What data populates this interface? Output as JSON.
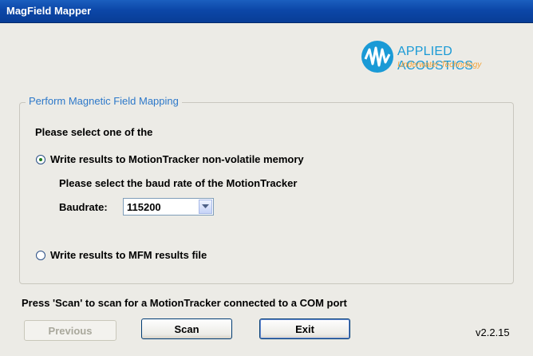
{
  "window": {
    "title": "MagField Mapper"
  },
  "logo": {
    "company": "APPLIED ACOUSTICS",
    "tagline": "Underwater Technology",
    "icon": "applied-acoustics-logo"
  },
  "group": {
    "legend": "Perform Magnetic Field Mapping",
    "prompt": "Please select one of the",
    "options": [
      {
        "label": "Write results to MotionTracker non-volatile memory",
        "selected": true
      },
      {
        "label": "Write results to MFM results file",
        "selected": false
      }
    ],
    "baud_prompt": "Please select the baud rate of the MotionTracker",
    "baud_label": "Baudrate:",
    "baud_value": "115200"
  },
  "instruction": "Press 'Scan' to scan for a MotionTracker connected to a COM port",
  "buttons": {
    "previous": "Previous",
    "scan": "Scan",
    "exit": "Exit"
  },
  "version": "v2.2.15",
  "colors": {
    "titlebar": "#0c47a8",
    "legend": "#2d78c9",
    "logo_blue": "#1a9ad6",
    "logo_orange": "#f2a33a"
  }
}
